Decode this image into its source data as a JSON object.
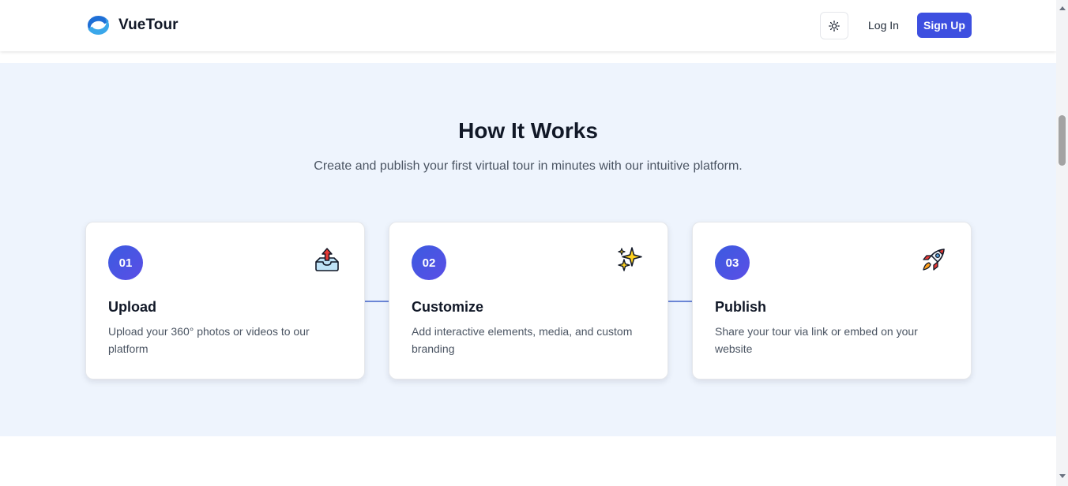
{
  "header": {
    "brand_name": "VueTour",
    "login_label": "Log In",
    "signup_label": "Sign Up",
    "theme_toggle_icon": "sun-icon",
    "brand_color": "#3d4fe0"
  },
  "how_it_works": {
    "title": "How It Works",
    "subtitle": "Create and publish your first virtual tour in minutes with our intuitive platform.",
    "steps": [
      {
        "number": "01",
        "title": "Upload",
        "description": "Upload your 360° photos or videos to our platform",
        "icon": "inbox-tray-upload-icon"
      },
      {
        "number": "02",
        "title": "Customize",
        "description": "Add interactive elements, media, and custom branding",
        "icon": "sparkles-icon"
      },
      {
        "number": "03",
        "title": "Publish",
        "description": "Share your tour via link or embed on your website",
        "icon": "rocket-icon"
      }
    ],
    "background_color": "#eef4fd",
    "badge_color": "#4657e2"
  }
}
